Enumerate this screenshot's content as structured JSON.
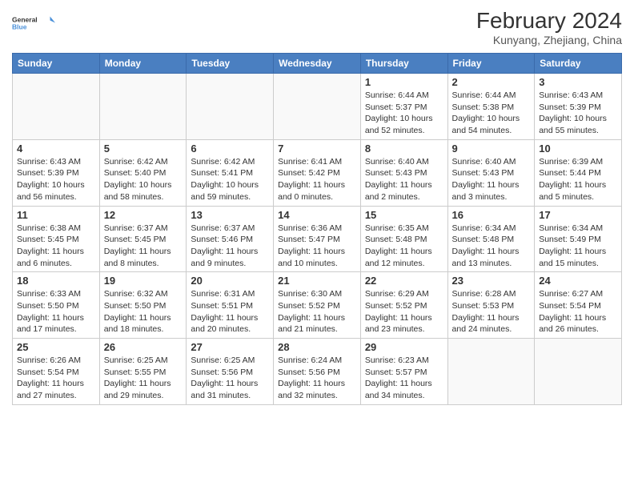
{
  "logo": {
    "line1": "General",
    "line2": "Blue"
  },
  "header": {
    "month_year": "February 2024",
    "location": "Kunyang, Zhejiang, China"
  },
  "days_of_week": [
    "Sunday",
    "Monday",
    "Tuesday",
    "Wednesday",
    "Thursday",
    "Friday",
    "Saturday"
  ],
  "weeks": [
    [
      {
        "day": "",
        "info": ""
      },
      {
        "day": "",
        "info": ""
      },
      {
        "day": "",
        "info": ""
      },
      {
        "day": "",
        "info": ""
      },
      {
        "day": "1",
        "info": "Sunrise: 6:44 AM\nSunset: 5:37 PM\nDaylight: 10 hours and 52 minutes."
      },
      {
        "day": "2",
        "info": "Sunrise: 6:44 AM\nSunset: 5:38 PM\nDaylight: 10 hours and 54 minutes."
      },
      {
        "day": "3",
        "info": "Sunrise: 6:43 AM\nSunset: 5:39 PM\nDaylight: 10 hours and 55 minutes."
      }
    ],
    [
      {
        "day": "4",
        "info": "Sunrise: 6:43 AM\nSunset: 5:39 PM\nDaylight: 10 hours and 56 minutes."
      },
      {
        "day": "5",
        "info": "Sunrise: 6:42 AM\nSunset: 5:40 PM\nDaylight: 10 hours and 58 minutes."
      },
      {
        "day": "6",
        "info": "Sunrise: 6:42 AM\nSunset: 5:41 PM\nDaylight: 10 hours and 59 minutes."
      },
      {
        "day": "7",
        "info": "Sunrise: 6:41 AM\nSunset: 5:42 PM\nDaylight: 11 hours and 0 minutes."
      },
      {
        "day": "8",
        "info": "Sunrise: 6:40 AM\nSunset: 5:43 PM\nDaylight: 11 hours and 2 minutes."
      },
      {
        "day": "9",
        "info": "Sunrise: 6:40 AM\nSunset: 5:43 PM\nDaylight: 11 hours and 3 minutes."
      },
      {
        "day": "10",
        "info": "Sunrise: 6:39 AM\nSunset: 5:44 PM\nDaylight: 11 hours and 5 minutes."
      }
    ],
    [
      {
        "day": "11",
        "info": "Sunrise: 6:38 AM\nSunset: 5:45 PM\nDaylight: 11 hours and 6 minutes."
      },
      {
        "day": "12",
        "info": "Sunrise: 6:37 AM\nSunset: 5:45 PM\nDaylight: 11 hours and 8 minutes."
      },
      {
        "day": "13",
        "info": "Sunrise: 6:37 AM\nSunset: 5:46 PM\nDaylight: 11 hours and 9 minutes."
      },
      {
        "day": "14",
        "info": "Sunrise: 6:36 AM\nSunset: 5:47 PM\nDaylight: 11 hours and 10 minutes."
      },
      {
        "day": "15",
        "info": "Sunrise: 6:35 AM\nSunset: 5:48 PM\nDaylight: 11 hours and 12 minutes."
      },
      {
        "day": "16",
        "info": "Sunrise: 6:34 AM\nSunset: 5:48 PM\nDaylight: 11 hours and 13 minutes."
      },
      {
        "day": "17",
        "info": "Sunrise: 6:34 AM\nSunset: 5:49 PM\nDaylight: 11 hours and 15 minutes."
      }
    ],
    [
      {
        "day": "18",
        "info": "Sunrise: 6:33 AM\nSunset: 5:50 PM\nDaylight: 11 hours and 17 minutes."
      },
      {
        "day": "19",
        "info": "Sunrise: 6:32 AM\nSunset: 5:50 PM\nDaylight: 11 hours and 18 minutes."
      },
      {
        "day": "20",
        "info": "Sunrise: 6:31 AM\nSunset: 5:51 PM\nDaylight: 11 hours and 20 minutes."
      },
      {
        "day": "21",
        "info": "Sunrise: 6:30 AM\nSunset: 5:52 PM\nDaylight: 11 hours and 21 minutes."
      },
      {
        "day": "22",
        "info": "Sunrise: 6:29 AM\nSunset: 5:52 PM\nDaylight: 11 hours and 23 minutes."
      },
      {
        "day": "23",
        "info": "Sunrise: 6:28 AM\nSunset: 5:53 PM\nDaylight: 11 hours and 24 minutes."
      },
      {
        "day": "24",
        "info": "Sunrise: 6:27 AM\nSunset: 5:54 PM\nDaylight: 11 hours and 26 minutes."
      }
    ],
    [
      {
        "day": "25",
        "info": "Sunrise: 6:26 AM\nSunset: 5:54 PM\nDaylight: 11 hours and 27 minutes."
      },
      {
        "day": "26",
        "info": "Sunrise: 6:25 AM\nSunset: 5:55 PM\nDaylight: 11 hours and 29 minutes."
      },
      {
        "day": "27",
        "info": "Sunrise: 6:25 AM\nSunset: 5:56 PM\nDaylight: 11 hours and 31 minutes."
      },
      {
        "day": "28",
        "info": "Sunrise: 6:24 AM\nSunset: 5:56 PM\nDaylight: 11 hours and 32 minutes."
      },
      {
        "day": "29",
        "info": "Sunrise: 6:23 AM\nSunset: 5:57 PM\nDaylight: 11 hours and 34 minutes."
      },
      {
        "day": "",
        "info": ""
      },
      {
        "day": "",
        "info": ""
      }
    ]
  ]
}
